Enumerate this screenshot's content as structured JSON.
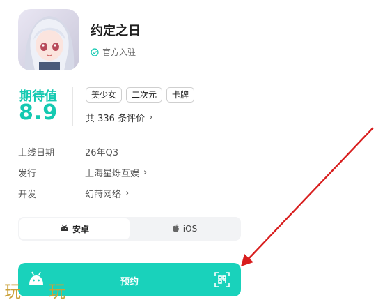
{
  "app": {
    "title": "约定之日",
    "official_label": "官方入驻"
  },
  "rating": {
    "label": "期待值",
    "value": "8.9"
  },
  "tags": [
    "美少女",
    "二次元",
    "卡牌"
  ],
  "reviews": {
    "text": "共 336 条评价"
  },
  "info": [
    {
      "label": "上线日期",
      "value": "26年Q3",
      "link": false
    },
    {
      "label": "发行",
      "value": "上海星烁互娱",
      "link": true
    },
    {
      "label": "开发",
      "value": "幻莳网络",
      "link": true
    }
  ],
  "platforms": {
    "android_label": "安卓",
    "ios_label": "iOS",
    "selected": "安卓"
  },
  "booking": {
    "label": "预约"
  },
  "watermark": {
    "left": "玩",
    "right": "玩"
  },
  "colors": {
    "accent": "#19d2bb",
    "annotation_arrow": "#d81e1e"
  },
  "icons": {
    "official": "verified-check-icon",
    "android": "android-icon",
    "ios": "apple-icon",
    "qr": "qr-scan-icon",
    "chevron": "chevron-right-icon"
  }
}
